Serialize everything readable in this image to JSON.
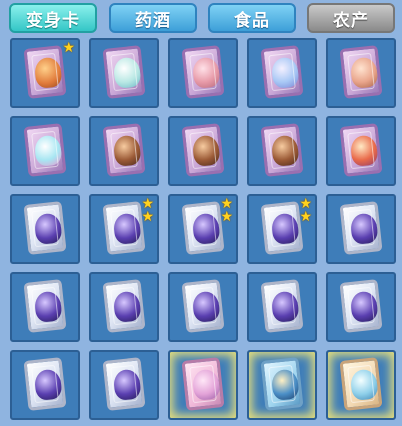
{
  "tabs": [
    {
      "label": "变身卡",
      "style": "active"
    },
    {
      "label": "药酒",
      "style": "blue"
    },
    {
      "label": "食品",
      "style": "blue"
    },
    {
      "label": "农产",
      "style": "gray"
    }
  ],
  "colors": {
    "background": "#8fb4e0",
    "slot": "#3e7db9",
    "active_tab": "#34c6c6",
    "tab": "#3d9fd8",
    "disabled_tab": "#8a8a8a",
    "star": "#ffd21f"
  },
  "grid": {
    "rows": [
      [
        {
          "card": "purple",
          "creature": "orange-fox-pet",
          "stars": 1
        },
        {
          "card": "purple",
          "creature": "unicorn-pet",
          "stars": 0
        },
        {
          "card": "purple",
          "creature": "deer-pet",
          "stars": 0
        },
        {
          "card": "purple",
          "creature": "dragon-pet",
          "stars": 0
        },
        {
          "card": "purple",
          "creature": "pig-pet",
          "stars": 0
        }
      ],
      [
        {
          "card": "purple",
          "creature": "bunny-pet",
          "stars": 0
        },
        {
          "card": "purple",
          "creature": "rider-character",
          "stars": 0
        },
        {
          "card": "purple",
          "creature": "rider-character",
          "stars": 0
        },
        {
          "card": "purple",
          "creature": "rider-character",
          "stars": 0
        },
        {
          "card": "purple",
          "creature": "clown-character",
          "stars": 0
        }
      ],
      [
        {
          "card": "silver",
          "creature": "purple-knight",
          "stars": 0
        },
        {
          "card": "silver",
          "creature": "purple-knight",
          "stars": 2
        },
        {
          "card": "silver",
          "creature": "purple-knight",
          "stars": 2
        },
        {
          "card": "silver",
          "creature": "purple-knight",
          "stars": 2
        },
        {
          "card": "silver",
          "creature": "purple-knight",
          "stars": 0
        }
      ],
      [
        {
          "card": "silver",
          "creature": "purple-knight",
          "stars": 0
        },
        {
          "card": "silver",
          "creature": "purple-knight",
          "stars": 0
        },
        {
          "card": "silver",
          "creature": "purple-knight",
          "stars": 0
        },
        {
          "card": "silver",
          "creature": "purple-knight",
          "stars": 0
        },
        {
          "card": "silver",
          "creature": "purple-knight",
          "stars": 0
        }
      ],
      [
        {
          "card": "silver",
          "creature": "purple-knight",
          "stars": 0
        },
        {
          "card": "silver",
          "creature": "purple-knight",
          "stars": 0
        },
        {
          "card": "pink",
          "creature": "fairy-character",
          "stars": 0,
          "highlight": true
        },
        {
          "card": "teal",
          "creature": "armored-warrior",
          "stars": 0,
          "highlight": true
        },
        {
          "card": "cream",
          "creature": "ice-beast",
          "stars": 0,
          "highlight": true
        }
      ]
    ]
  }
}
